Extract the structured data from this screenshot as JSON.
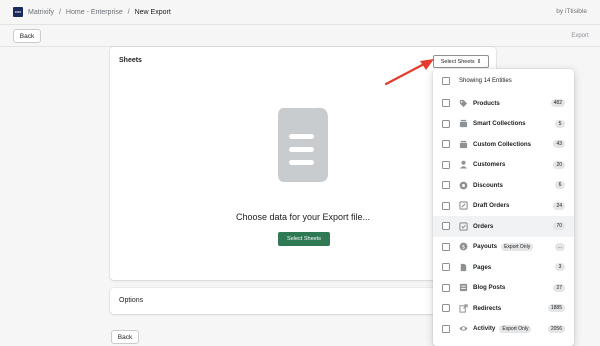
{
  "header": {
    "logo_text": "CSV",
    "breadcrumb": [
      "Matrixify",
      "Home - Enterprise",
      "New Export"
    ],
    "separator": "/",
    "byline": "by iTtisible"
  },
  "actions": {
    "back_label": "Back",
    "export_label": "Export"
  },
  "sheets_card": {
    "title": "Sheets",
    "choose_text": "Choose data for your Export file...",
    "select_button_label": "Select Sheets",
    "select_button_chevron": "⇕"
  },
  "options_card": {
    "title": "Options"
  },
  "bottom": {
    "back_label": "Back"
  },
  "dropdown": {
    "header": "Showing 14 Entities",
    "items": [
      {
        "label": "Products",
        "count": "482",
        "icon": "tag-icon"
      },
      {
        "label": "Smart Collections",
        "count": "5",
        "icon": "collection-icon"
      },
      {
        "label": "Custom Collections",
        "count": "43",
        "icon": "collection-icon"
      },
      {
        "label": "Customers",
        "count": "20",
        "icon": "person-icon"
      },
      {
        "label": "Discounts",
        "count": "6",
        "icon": "discount-icon"
      },
      {
        "label": "Draft Orders",
        "count": "24",
        "icon": "draft-icon"
      },
      {
        "label": "Orders",
        "count": "70",
        "icon": "orders-icon"
      },
      {
        "label": "Payouts",
        "count": "...",
        "tag": "Export Only",
        "icon": "dollar-icon"
      },
      {
        "label": "Pages",
        "count": "3",
        "icon": "page-icon"
      },
      {
        "label": "Blog Posts",
        "count": "27",
        "icon": "blog-icon"
      },
      {
        "label": "Redirects",
        "count": "1885",
        "icon": "redirect-icon"
      },
      {
        "label": "Activity",
        "count": "2056",
        "tag": "Export Only",
        "icon": "eye-icon"
      }
    ]
  },
  "colors": {
    "accent_green": "#2f7a55",
    "arrow_red": "#e53b2c",
    "logo_navy": "#1b2a5c"
  }
}
